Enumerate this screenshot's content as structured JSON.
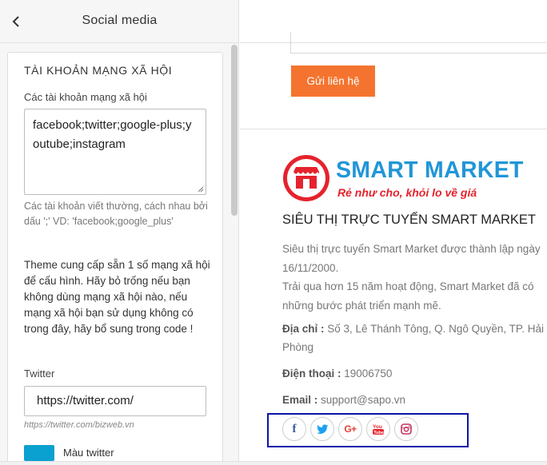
{
  "sidebar": {
    "header_title": "Social media",
    "section_title": "TÀI KHOẢN MẠNG XÃ HỘI",
    "accounts_label": "Các tài khoản mạng xã hội",
    "accounts_value": "facebook;twitter;google-plus;youtube;instagram",
    "accounts_hint": "Các tài khoản viết thường, cách nhau bởi dấu ';' VD: 'facebook;google_plus'",
    "description": "Theme cung cấp sẵn 1 số mạng xã hội để cấu hình. Hãy bỏ trống nếu bạn không dùng mạng xã hội nào, nếu mạng xã hội bạn sử dụng không có trong đây, hãy bổ sung trong code !",
    "twitter_label": "Twitter",
    "twitter_value": "https://twitter.com/",
    "twitter_hint": "https://twitter.com/bizweb.vn",
    "twitter_color_label": "Màu twitter",
    "twitter_color": "#0aa0cf"
  },
  "preview": {
    "send_button": "Gửi liên hệ",
    "brand_name": "SMART MARKET",
    "slogan": "Rẻ như cho, khỏi lo về giá",
    "store_title": "SIÊU THỊ TRỰC TUYẾN SMART MARKET",
    "about_1": "Siêu thị trực tuyến Smart Market được thành lập ngày 16/11/2000.",
    "about_2": "Trải qua hơn 15 năm hoạt động, Smart Market đã có những bước phát triển mạnh mẽ.",
    "address_label": "Địa chỉ :",
    "address_value": "Số 3, Lê Thánh Tông, Q. Ngô Quyền, TP. Hải Phòng",
    "phone_label": "Điện thoại :",
    "phone_value": "19006750",
    "email_label": "Email :",
    "email_value": "support@sapo.vn",
    "social_icons": [
      "facebook-icon",
      "twitter-icon",
      "google-plus-icon",
      "youtube-icon",
      "instagram-icon"
    ]
  },
  "colors": {
    "accent_orange": "#f4742f",
    "brand_blue": "#2196d7",
    "brand_red": "#e4232d",
    "highlight_box": "#0b14a8"
  }
}
